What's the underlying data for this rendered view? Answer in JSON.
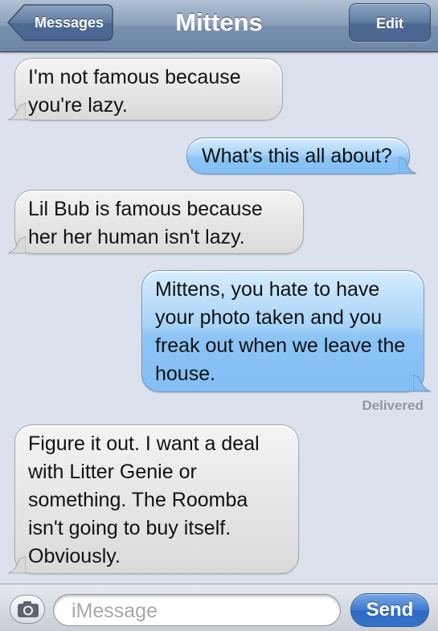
{
  "navbar": {
    "back_label": "Messages",
    "title": "Mittens",
    "edit_label": "Edit"
  },
  "messages": [
    {
      "direction": "incoming",
      "text": "I'm not famous because you're lazy."
    },
    {
      "direction": "outgoing",
      "text": "What's this all about?"
    },
    {
      "direction": "incoming",
      "text": "Lil Bub is famous because her her human isn't lazy."
    },
    {
      "direction": "outgoing",
      "text": "Mittens, you hate to have your photo taken and you freak out when we leave the house."
    },
    {
      "direction": "incoming",
      "text": "Figure it out. I want a deal with Litter Genie or something. The Roomba isn't going to buy itself. Obviously."
    }
  ],
  "status": {
    "delivered": "Delivered"
  },
  "composer": {
    "camera_icon": "camera-icon",
    "placeholder": "iMessage",
    "value": "",
    "send_label": "Send"
  },
  "colors": {
    "navbar": "#7890af",
    "background": "#dbe2ed",
    "incoming_bubble": "#e5e5e5",
    "outgoing_bubble": "#a8d4f8",
    "send_button": "#3f7ad0"
  }
}
